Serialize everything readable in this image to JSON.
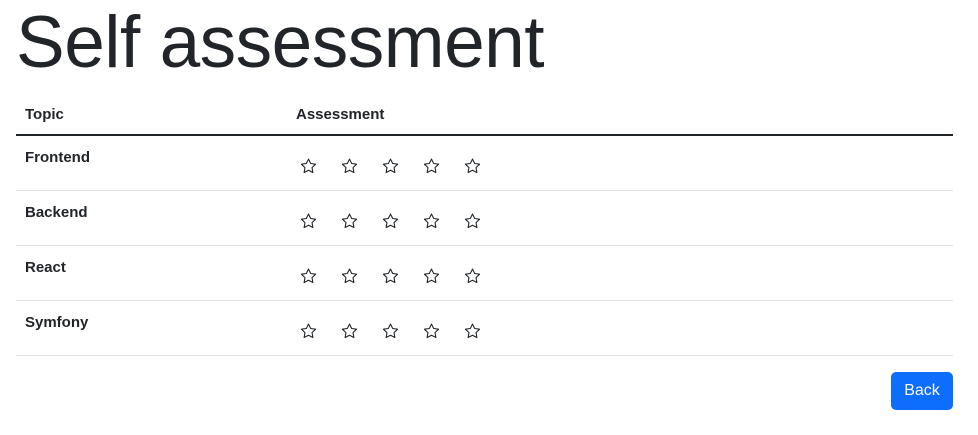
{
  "page": {
    "title": "Self assessment"
  },
  "table": {
    "headers": {
      "topic": "Topic",
      "assessment": "Assessment"
    },
    "rows": [
      {
        "topic": "Frontend",
        "rating": 0,
        "max": 5
      },
      {
        "topic": "Backend",
        "rating": 0,
        "max": 5
      },
      {
        "topic": "React",
        "rating": 0,
        "max": 5
      },
      {
        "topic": "Symfony",
        "rating": 0,
        "max": 5
      }
    ]
  },
  "actions": {
    "back_label": "Back"
  },
  "colors": {
    "primary": "#0d6efd",
    "text": "#212529",
    "divider": "#dee2e6"
  },
  "icons": {
    "rating": "star-outline-icon"
  }
}
